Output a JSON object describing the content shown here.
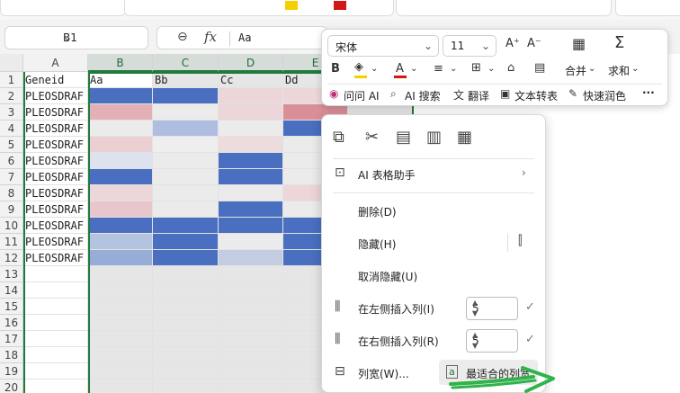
{
  "name_box": {
    "value": "B1"
  },
  "formula_bar": {
    "value": "Aa"
  },
  "columns": [
    "A",
    "B",
    "C",
    "D",
    "E"
  ],
  "rows": [
    "1",
    "2",
    "3",
    "4",
    "5",
    "6",
    "7",
    "8",
    "9",
    "10",
    "11",
    "12",
    "13",
    "14",
    "15",
    "16",
    "17",
    "18",
    "19",
    "20"
  ],
  "header_row": [
    "Geneid",
    "Aa",
    "Bb",
    "Cc",
    "Dd"
  ],
  "gene_ids": [
    "PLEOSDRAF",
    "PLEOSDRAF",
    "PLEOSDRAF",
    "PLEOSDRAF",
    "PLEOSDRAF",
    "PLEOSDRAF",
    "PLEOSDRAF",
    "PLEOSDRAF",
    "PLEOSDRAF",
    "PLEOSDRAF",
    "PLEOSDRAF"
  ],
  "heat_colors": {
    "B": [
      "#4a6fc0",
      "#e3b0b7",
      "#ebebeb",
      "#eccfd3",
      "#dde2ef",
      "#4a6fc0",
      "#ecd6d9",
      "#e7c7cc",
      "#4a6fc0",
      "#b4c3df",
      "#97acd6"
    ],
    "C": [
      "#4a6fc0",
      "#ebebeb",
      "#afbee0",
      "#eeeeee",
      "#ebebeb",
      "#ebebeb",
      "#ebebeb",
      "#ebebeb",
      "#4a6fc0",
      "#4a6fc0",
      "#4a6fc0"
    ],
    "D": [
      "#ecd6d9",
      "#ecd6d9",
      "#ebebeb",
      "#ecdcde",
      "#4a6fc0",
      "#4a6fc0",
      "#ebebeb",
      "#4a6fc0",
      "#4a6fc0",
      "#ebebeb",
      "#c3cce0"
    ],
    "E": [
      "#ecd6d9",
      "#da8f98",
      "#4a6fc0",
      "#ebebeb",
      "#ebebeb",
      "#ebebeb",
      "#ecd6d9",
      "#ebebeb",
      "#4a6fc0",
      "#4a6fc0",
      "#4a6fc0"
    ]
  },
  "mini_toolbar": {
    "font_name": "宋体",
    "font_size": "11",
    "merge_label": "合并",
    "sum_label": "求和",
    "ai_ask": "问问 AI",
    "ai_search": "AI 搜索",
    "translate": "翻译",
    "text_to_table": "文本转表",
    "quick_color": "快速润色",
    "more": "···"
  },
  "context_menu": {
    "ai_assistant": "AI 表格助手",
    "delete": "删除(D)",
    "hide": "隐藏(H)",
    "unhide": "取消隐藏(U)",
    "insert_left": "在左侧插入列(I)",
    "insert_left_count": "5",
    "insert_right": "在右侧插入列(R)",
    "insert_right_count": "5",
    "col_width": "列宽(W)...",
    "best_fit": "最适合的列宽"
  },
  "colors": {
    "selection_green": "#1f7a3d",
    "arrow_green": "#2fb34a",
    "heat_blue": "#4a6fc0",
    "heat_red": "#da8f98"
  }
}
